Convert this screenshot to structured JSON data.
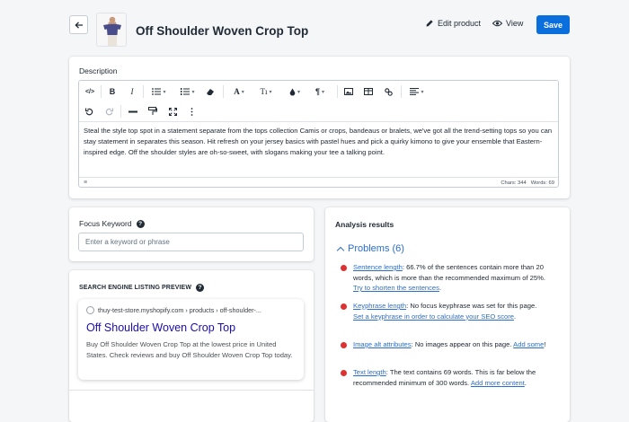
{
  "header": {
    "title": "Off Shoulder Woven Crop Top",
    "edit_product": "Edit product",
    "view": "View",
    "save": "Save"
  },
  "description": {
    "label": "Description",
    "text": "Steal the style top spot in a statement separate from the tops collection Camis or crops, bandeaus or bralets, we've got all the trend-setting tops so you can stay statement in separates this season. Hit refresh on your jersey basics with pastel hues and pick a quirky kimono to give your ensemble that Eastern-inspired edge. Off the shoulder styles are oh-so-sweet, with slogans making your tee a talking point.",
    "chars": "Chars: 344",
    "words": "Words: 69",
    "heading_button": "¶"
  },
  "focus": {
    "label": "Focus Keyword",
    "placeholder": "Enter a keyword or phrase"
  },
  "serp": {
    "label": "SEARCH ENGINE LISTING PREVIEW",
    "url": "thuy-test-store.myshopify.com › products › off-shoulder-...",
    "title": "Off Shoulder Woven Crop Top",
    "description": "Buy Off Shoulder Woven Crop Top at the lowest price in United States. Check reviews and buy Off Shoulder Woven Crop Top today."
  },
  "analysis": {
    "title": "Analysis results",
    "problems_label": "Problems (6)",
    "issues": [
      {
        "name": "Sentence length",
        "text": ": 66.7% of the sentences contain more than 20 words, which is more than the recommended maximum of 25%. ",
        "link": "Try to shorten the sentences",
        "tail": "."
      },
      {
        "name": "Keyphrase length",
        "text": ": No focus keyphrase was set for this page. ",
        "link": "Set a keyphrase in order to calculate your SEO score",
        "tail": "."
      },
      {
        "name": "Image alt attributes",
        "text": ": No images appear on this page. ",
        "link": "Add some",
        "tail": "!"
      },
      {
        "name": "Text length",
        "text": ": The text contains 69 words. This is far below the recommended minimum of 300 words. ",
        "link": "Add more content",
        "tail": "."
      }
    ]
  },
  "colors": {
    "primary": "#0a6edd",
    "link": "#2c6ecb",
    "problem": "#dc3232",
    "serp_title": "#1a0dab"
  }
}
